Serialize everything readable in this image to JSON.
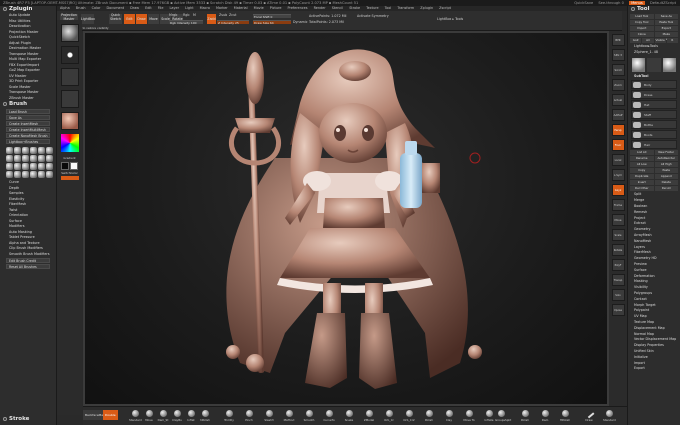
{
  "titlebar": {
    "app_title": "ZBrush 4R7 P3 [LAPTOP-OEMT-MSS7JRO] Ultimate:   ZBrush Document   ▪ Free Mem 17.976GB ▪ Active Mem 3533 ▪ Scratch Disk 49 ▪ Timer 0.03 ▪ ATime 0.01 ▪ PolyCount 2.073 MP ▪ MeshCount 51",
    "quicksave": "QuickSave",
    "see_through": "See-through  0",
    "menus": "Menus",
    "default_zscript": "DefaultZScript"
  },
  "menubar": [
    "Alpha",
    "Brush",
    "Color",
    "Document",
    "Draw",
    "Edit",
    "File",
    "Layer",
    "Light",
    "Macro",
    "Marker",
    "Material",
    "Movie",
    "Picture",
    "Preferences",
    "Render",
    "Stencil",
    "Stroke",
    "Texture",
    "Tool",
    "Transform",
    "Zplugin",
    "Zscript"
  ],
  "left_palette": {
    "title": "Zplugin",
    "items": [
      "Auto Update",
      "Misc Utilities",
      "Deactivation",
      "Projection Master",
      "QuickSketch",
      "Adjust Plugin",
      "Decimation Master",
      "Transpose Master",
      "Multi Map Exporter",
      "FBX ExportImport",
      "GoZ Map Exporter",
      "UV Master",
      "3D Print Exporter",
      "Scale Master",
      "Transpose Master",
      "ZBrush Master"
    ],
    "brush_title": "Brush",
    "brush_buttons": [
      "Load Brush",
      "Save As",
      "Create InsertMesh",
      "Create InsertMultiMesh",
      "Create NanoMesh Brush",
      "Lightbox→Brushes"
    ],
    "brush_items": [
      "Curve",
      "Depth",
      "Samples",
      "Elasticity",
      "FiberMesh",
      "Twist",
      "Orientation",
      "Surface",
      "Modifiers",
      "Auto Masking",
      "Tablet Pressure",
      "Alpha and Texture",
      "Clip Brush Modifiers",
      "Smooth Brush Modifiers"
    ],
    "reset_buttons": [
      "Edit Brush Credit",
      "Reset All Brushes"
    ],
    "stroke_title": "Stroke",
    "gradient_label": "Gradient",
    "switch_color_label": "SwitchColor"
  },
  "toolbar": {
    "projection_master": "Projection Master",
    "lightbox": "LightBox",
    "quick_sketch": "Quick Sketch",
    "edit": "Edit",
    "draw": "Draw",
    "move": "Move",
    "scale": "Scale",
    "rotate": "Rotate",
    "mrgb": "Mrgb",
    "rgb": "Rgb",
    "m": "M",
    "zadd": "Zadd",
    "zsub": "Zsub",
    "zcut": "Zcut",
    "rgb_intensity": "Rgb Intensity 100",
    "z_intensity": "Z Intensity 25",
    "focal_shift": "Focal Shift 0",
    "draw_size": "Draw Size 64",
    "dynamic": "Dynamic",
    "active_points": "ActivePoints: 1.072 Mil",
    "total_points": "TotalPoints: 2.073 Mil",
    "symmetry": "Activate Symmetry",
    "lightbox_right": "LightBox ▸ Tools"
  },
  "status_note": "Ctrl+Shift+Click to restore visibility",
  "right_shelf": [
    "BPR",
    "SPix 3",
    "Scroll",
    "Zoom",
    "Actual",
    "AAHalf",
    "Persp",
    "Floor",
    "Local",
    "L.Sym",
    "Gxyz",
    "Frame",
    "Move",
    "Scale",
    "Rotate",
    "PolyF",
    "Transp",
    "Solo",
    "Xpose"
  ],
  "right_palette": {
    "title": "Tool",
    "buttons": [
      "Load Tool",
      "Save As",
      "Copy Tool",
      "Paste Tool",
      "Import",
      "Export",
      "Clone",
      "Make PolyMesh3D",
      "GoZ",
      "All",
      "Visible",
      "R"
    ],
    "lightbox_tools": "Lightbox▸Tools",
    "zsphere_label": "ZSphere_1. 48",
    "subtool_label": "SubTool",
    "list_all": "List All",
    "new_folder": "New Folder",
    "subtools": [
      "Body",
      "Dress",
      "Hat",
      "Staff",
      "Bottle",
      "Boots",
      "Hair"
    ],
    "sections": [
      "Rename",
      "AutoReorder",
      "All Low",
      "All High",
      "Copy",
      "Paste",
      "Duplicate",
      "Append",
      "Insert",
      "Delete",
      "Del Other",
      "Del All",
      "Split",
      "Merge",
      "Boolean",
      "Remesh",
      "Project",
      "Extract"
    ],
    "panels": [
      "Geometry",
      "ArrayMesh",
      "NanoMesh",
      "Layers",
      "FiberMesh",
      "Geometry HD",
      "Preview",
      "Surface",
      "Deformation",
      "Masking",
      "Visibility",
      "Polygroups",
      "Contact",
      "Morph Target",
      "Polypaint",
      "UV Map",
      "Texture Map",
      "Displacement Map",
      "Normal Map",
      "Vector Displacement Map",
      "Display Properties",
      "Unified Skin",
      "Initialize",
      "Import",
      "Export"
    ]
  },
  "bottom_bar": {
    "backface": "BackfaceMask",
    "double": "Double",
    "brushes": [
      "Standard",
      "Move",
      "Dam_St",
      "ClayBu",
      "Inflat",
      "hPolish",
      "TrimDy",
      "Pinch",
      "Slash3",
      "MAHcut",
      "Smooth",
      "CurveTu",
      "Snake",
      "ZModel",
      "Orb_Cr",
      "Orb_Cr2",
      "Polish",
      "Clay",
      "Move To",
      "Inflate"
    ],
    "right_labels": [
      "GroupsSplit",
      "Polish",
      "Dam",
      "HPolish"
    ],
    "end_labels": [
      "Draw",
      "Standard"
    ]
  }
}
